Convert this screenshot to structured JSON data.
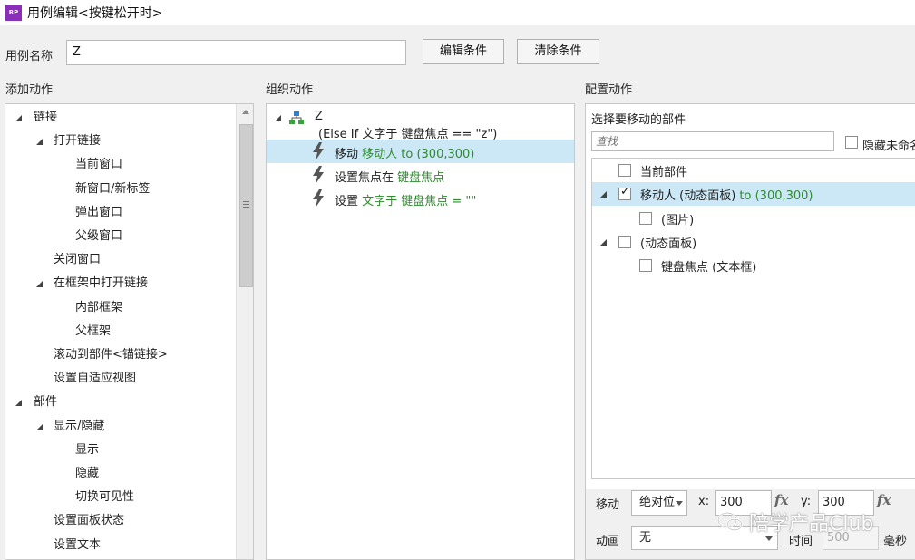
{
  "window": {
    "title": "用例编辑<按键松开时>"
  },
  "case_name": {
    "label": "用例名称",
    "value": "Z"
  },
  "buttons": {
    "edit_condition": "编辑条件",
    "clear_condition": "清除条件"
  },
  "sections": {
    "add_action": "添加动作",
    "organize_action": "组织动作",
    "configure_action": "配置动作"
  },
  "add_action_tree": [
    {
      "label": "链接",
      "level": 0,
      "expanded": true
    },
    {
      "label": "打开链接",
      "level": 1,
      "expanded": true
    },
    {
      "label": "当前窗口",
      "level": 2
    },
    {
      "label": "新窗口/新标签",
      "level": 2
    },
    {
      "label": "弹出窗口",
      "level": 2
    },
    {
      "label": "父级窗口",
      "level": 2
    },
    {
      "label": "关闭窗口",
      "level": 1
    },
    {
      "label": "在框架中打开链接",
      "level": 1,
      "expanded": true
    },
    {
      "label": "内部框架",
      "level": 2
    },
    {
      "label": "父框架",
      "level": 2
    },
    {
      "label": "滚动到部件<锚链接>",
      "level": 1
    },
    {
      "label": "设置自适应视图",
      "level": 1
    },
    {
      "label": "部件",
      "level": 0,
      "expanded": true
    },
    {
      "label": "显示/隐藏",
      "level": 1,
      "expanded": true
    },
    {
      "label": "显示",
      "level": 2
    },
    {
      "label": "隐藏",
      "level": 2
    },
    {
      "label": "切换可见性",
      "level": 2
    },
    {
      "label": "设置面板状态",
      "level": 1
    },
    {
      "label": "设置文本",
      "level": 1
    }
  ],
  "organize": {
    "case_title": "Z",
    "condition": "(Else If 文字于 键盘焦点 == \"z\")",
    "actions": [
      {
        "prefix": "移动 ",
        "detail": "移动人 to (300,300)",
        "selected": true
      },
      {
        "prefix": "设置焦点在 ",
        "detail": "键盘焦点",
        "selected": false
      },
      {
        "prefix": "设置 ",
        "detail": "文字于 键盘焦点 = \"\"",
        "selected": false
      }
    ]
  },
  "configure": {
    "select_widget_label": "选择要移动的部件",
    "search_placeholder": "查找",
    "hide_unnamed_label": "隐藏未命名",
    "widgets": [
      {
        "label": "当前部件",
        "extra": "",
        "checked": false,
        "level": 0,
        "toggle": false
      },
      {
        "label": "移动人 (动态面板)",
        "extra": " to (300,300)",
        "checked": true,
        "level": 0,
        "toggle": true,
        "highlight": true
      },
      {
        "label": "(图片)",
        "extra": "",
        "checked": false,
        "level": 1,
        "toggle": false
      },
      {
        "label": "(动态面板)",
        "extra": "",
        "checked": false,
        "level": 0,
        "toggle": true
      },
      {
        "label": "键盘焦点 (文本框)",
        "extra": "",
        "checked": false,
        "level": 1,
        "toggle": false
      }
    ],
    "move_label": "移动",
    "move_mode": "绝对位",
    "x_label": "x:",
    "x_value": "300",
    "y_label": "y:",
    "y_value": "300",
    "fx": "fx",
    "animation_label": "动画",
    "animation_value": "无",
    "time_label": "时间",
    "time_value": "500",
    "time_unit": "毫秒"
  },
  "watermark": "陪学产品Club",
  "colors": {
    "selection": "#cce8f6",
    "action_detail": "#2e8b2e",
    "app_icon": "#8a2fb8"
  }
}
